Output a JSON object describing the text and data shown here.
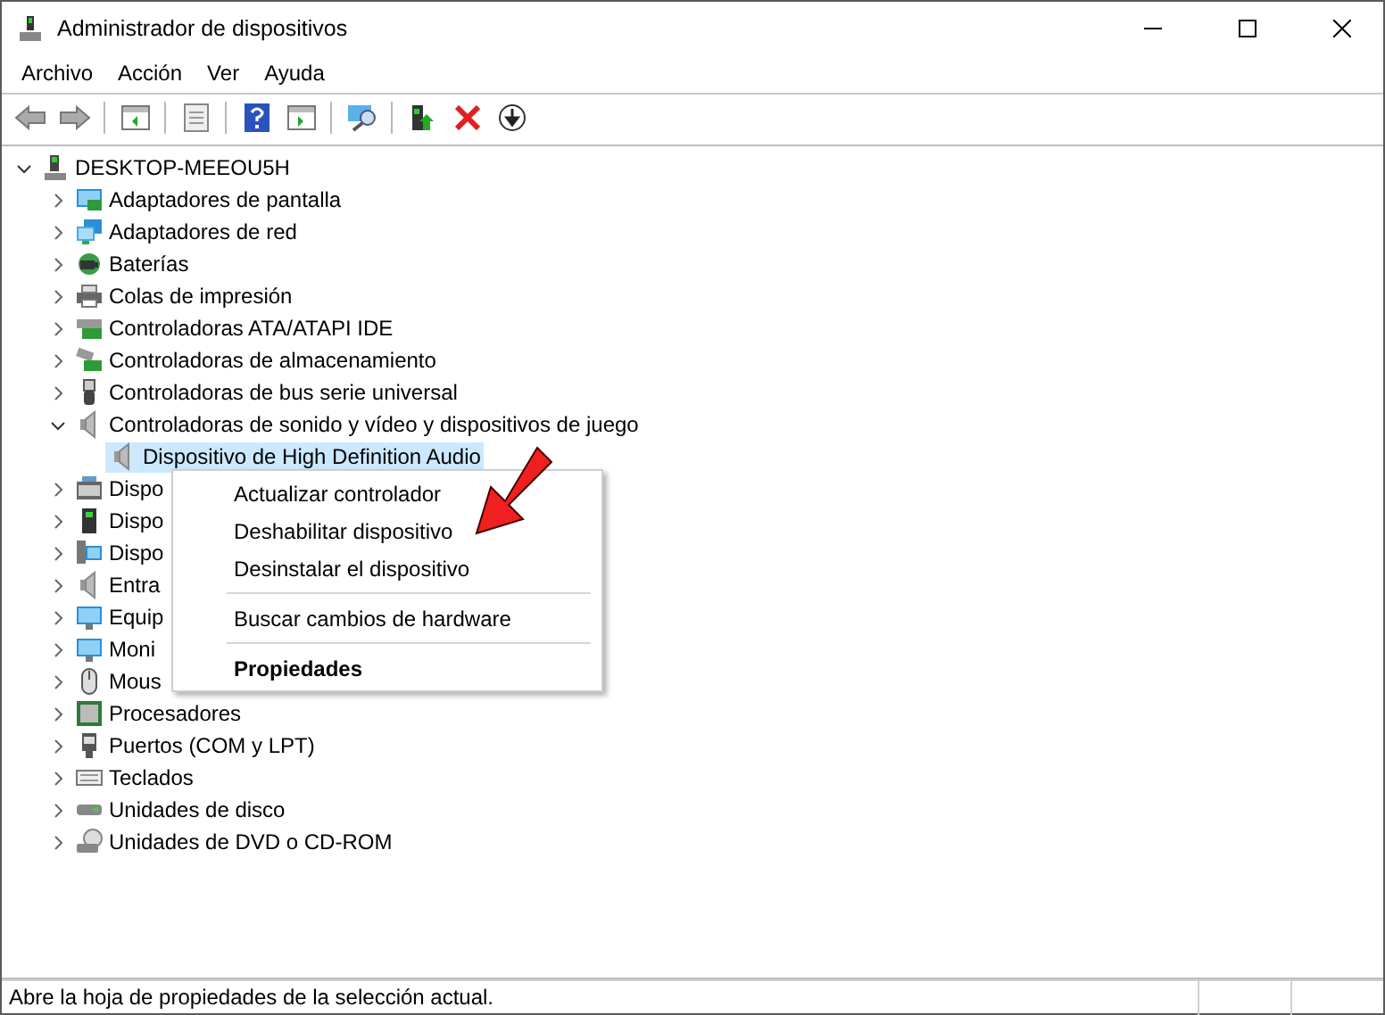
{
  "window": {
    "title": "Administrador de dispositivos"
  },
  "menu": [
    "Archivo",
    "Acción",
    "Ver",
    "Ayuda"
  ],
  "tree": {
    "label": "DESKTOP-MEEOU5H",
    "expanded": true,
    "selected": false,
    "children": [
      {
        "label": "Adaptadores de pantalla",
        "expanded": false,
        "selected": false
      },
      {
        "label": "Adaptadores de red",
        "expanded": false,
        "selected": false
      },
      {
        "label": "Baterías",
        "expanded": false,
        "selected": false
      },
      {
        "label": "Colas de impresión",
        "expanded": false,
        "selected": false
      },
      {
        "label": "Controladoras ATA/ATAPI IDE",
        "expanded": false,
        "selected": false
      },
      {
        "label": "Controladoras de almacenamiento",
        "expanded": false,
        "selected": false
      },
      {
        "label": "Controladoras de bus serie universal",
        "expanded": false,
        "selected": false
      },
      {
        "label": "Controladoras de sonido y vídeo y dispositivos de juego",
        "expanded": true,
        "selected": false,
        "children": [
          {
            "label": "Dispositivo de High Definition Audio",
            "selected": true
          }
        ]
      },
      {
        "label": "Dispo",
        "expanded": false,
        "selected": false
      },
      {
        "label": "Dispo",
        "expanded": false,
        "selected": false
      },
      {
        "label": "Dispo",
        "expanded": false,
        "selected": false
      },
      {
        "label": "Entra",
        "expanded": false,
        "selected": false
      },
      {
        "label": "Equip",
        "expanded": false,
        "selected": false
      },
      {
        "label": "Moni",
        "expanded": false,
        "selected": false
      },
      {
        "label": "Mous",
        "expanded": false,
        "selected": false
      },
      {
        "label": "Procesadores",
        "expanded": false,
        "selected": false
      },
      {
        "label": "Puertos (COM y LPT)",
        "expanded": false,
        "selected": false
      },
      {
        "label": "Teclados",
        "expanded": false,
        "selected": false
      },
      {
        "label": "Unidades de disco",
        "expanded": false,
        "selected": false
      },
      {
        "label": "Unidades de DVD o CD-ROM",
        "expanded": false,
        "selected": false
      }
    ]
  },
  "context_menu": {
    "groups": [
      [
        {
          "label": "Actualizar controlador",
          "default": false
        },
        {
          "label": "Deshabilitar dispositivo",
          "default": false
        },
        {
          "label": "Desinstalar el dispositivo",
          "default": false
        }
      ],
      [
        {
          "label": "Buscar cambios de hardware",
          "default": false
        }
      ],
      [
        {
          "label": "Propiedades",
          "default": true
        }
      ]
    ]
  },
  "status_bar": {
    "text": "Abre la hoja de propiedades de la selección actual."
  }
}
